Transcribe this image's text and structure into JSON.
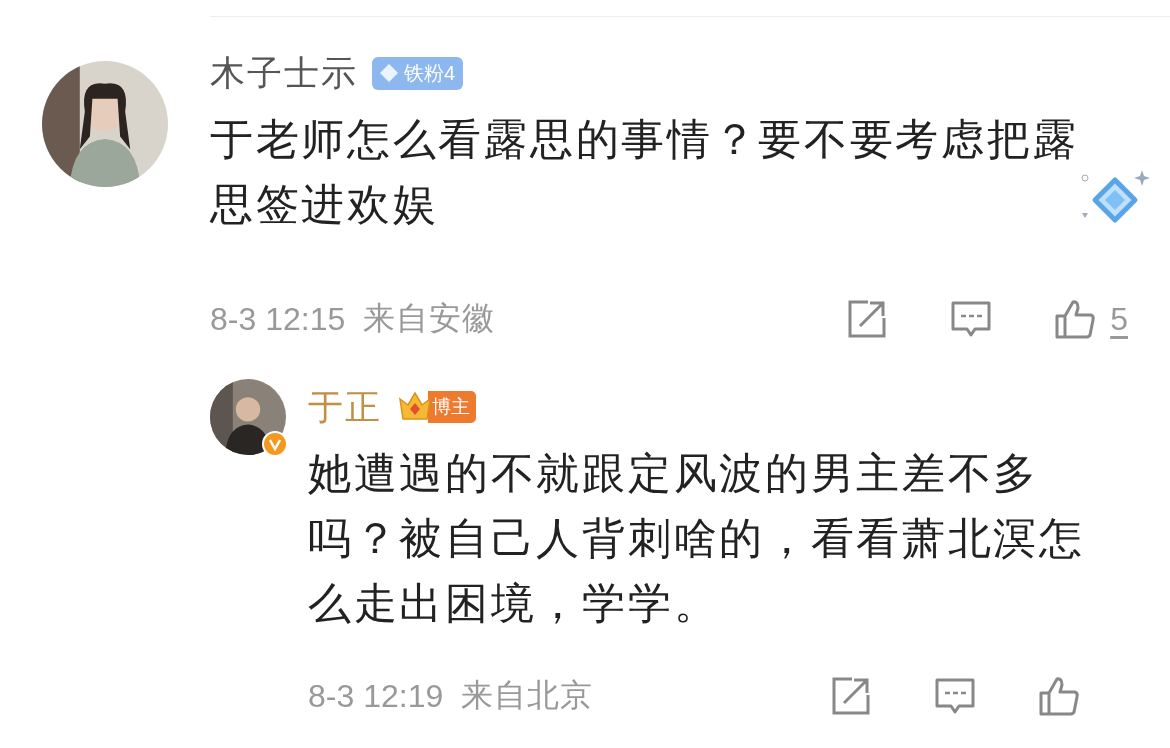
{
  "comments": [
    {
      "kind": "comment",
      "user": {
        "name": "木子士示",
        "badge": {
          "kind": "fan",
          "label": "铁粉4"
        },
        "verified": false
      },
      "text": "于老师怎么看露思的事情？要不要考虑把露思签进欢娱",
      "decorated": true,
      "time": "8-3 12:15",
      "location": "来自安徽",
      "likes": "5"
    },
    {
      "kind": "reply",
      "user": {
        "name": "于正",
        "badge": {
          "kind": "blogger",
          "label": "博主"
        },
        "verified": true
      },
      "text": "她遭遇的不就跟定风波的男主差不多吗？被自己人背刺啥的，看看萧北溟怎么走出困境，学学。",
      "decorated": false,
      "time": "8-3 12:19",
      "location": "来自北京"
    }
  ]
}
